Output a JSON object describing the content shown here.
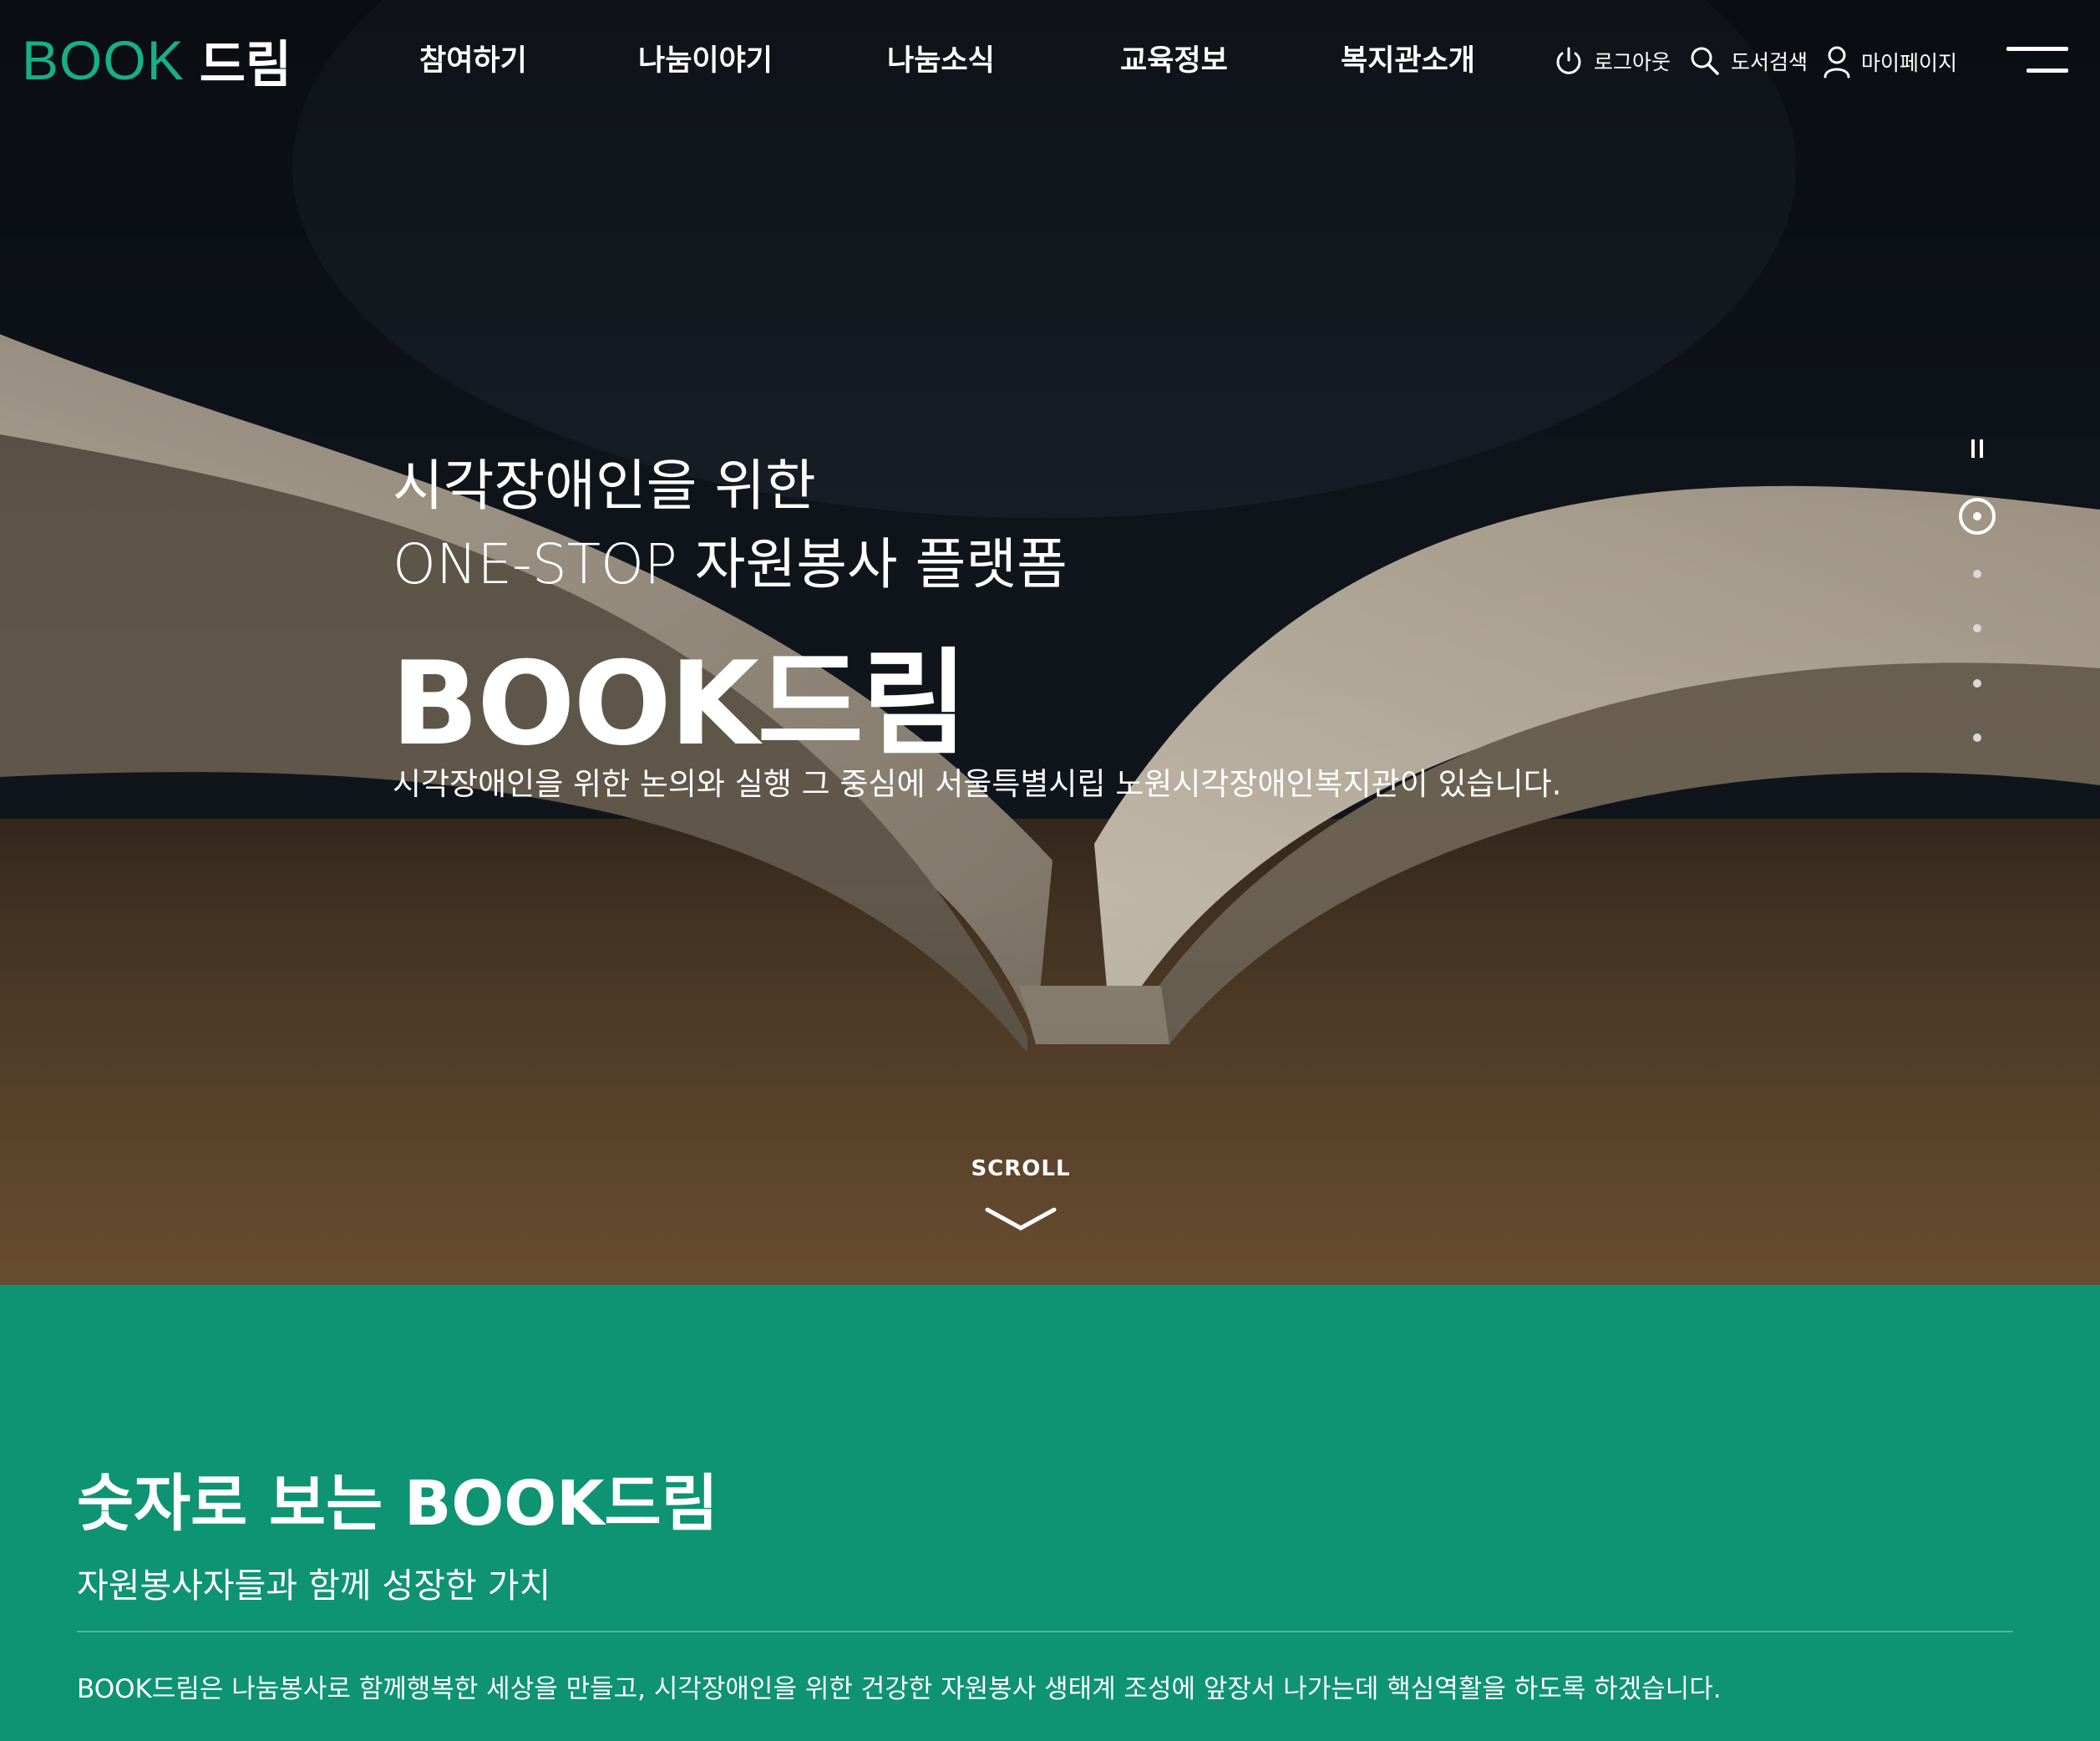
{
  "header": {
    "logo_book": "BOOK",
    "logo_dream": "드림",
    "nav": [
      "참여하기",
      "나눔이야기",
      "나눔소식",
      "교육정보",
      "복지관소개"
    ],
    "util": {
      "logout": "로그아웃",
      "search": "도서검색",
      "mypage": "마이페이지"
    }
  },
  "hero": {
    "subtitle_1": "시각장애인을 위한",
    "subtitle_2": "ONE-STOP 자원봉사 플랫폼",
    "title": "BOOK드림",
    "description": "시각장애인을 위한 논의와 실행 그 중심에 서울특별시립 노원시각장애인복지관이 있습니다.",
    "scroll_label": "SCROLL",
    "slides_total": 5,
    "slide_active": 1
  },
  "stats": {
    "title": "숫자로 보는 BOOK드림",
    "subtitle": "자원봉사자들과 함께 성장한 가치",
    "description": "BOOK드림은 나눔봉사로 함께행복한 세상을 만들고, 시각장애인을 위한 건강한 자원봉사 생태계 조성에 앞장서 나가는데 핵심역활을 하도록 하겠습니다."
  },
  "colors": {
    "brand_green": "#0e9373",
    "logo_green": "#17b085"
  }
}
